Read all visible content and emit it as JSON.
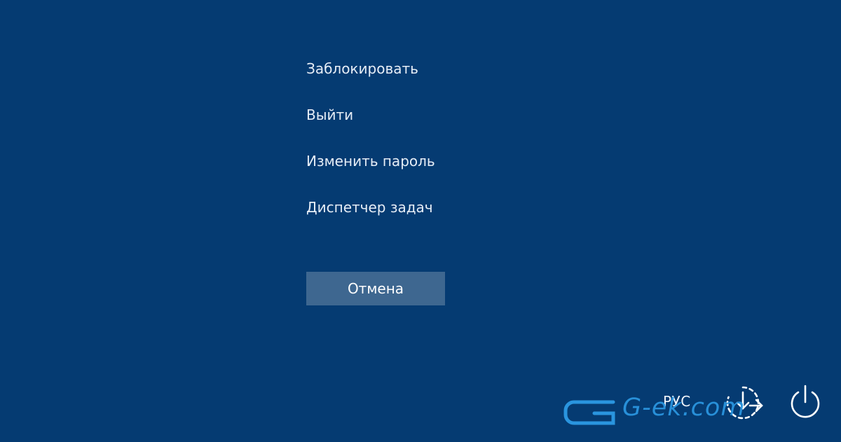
{
  "menu": {
    "items": [
      {
        "label": "Заблокировать"
      },
      {
        "label": "Выйти"
      },
      {
        "label": "Изменить пароль"
      },
      {
        "label": "Диспетчер задач"
      }
    ],
    "cancel_label": "Отмена"
  },
  "system_tray": {
    "language": "РУС",
    "ease_of_access_icon": "ease-of-access-icon",
    "power_icon": "power-icon"
  },
  "watermark": {
    "text": "G-ek.com"
  },
  "colors": {
    "background": "#053b72",
    "button": "#3e6790",
    "text": "#e6edf6",
    "watermark": "#2a95df"
  }
}
